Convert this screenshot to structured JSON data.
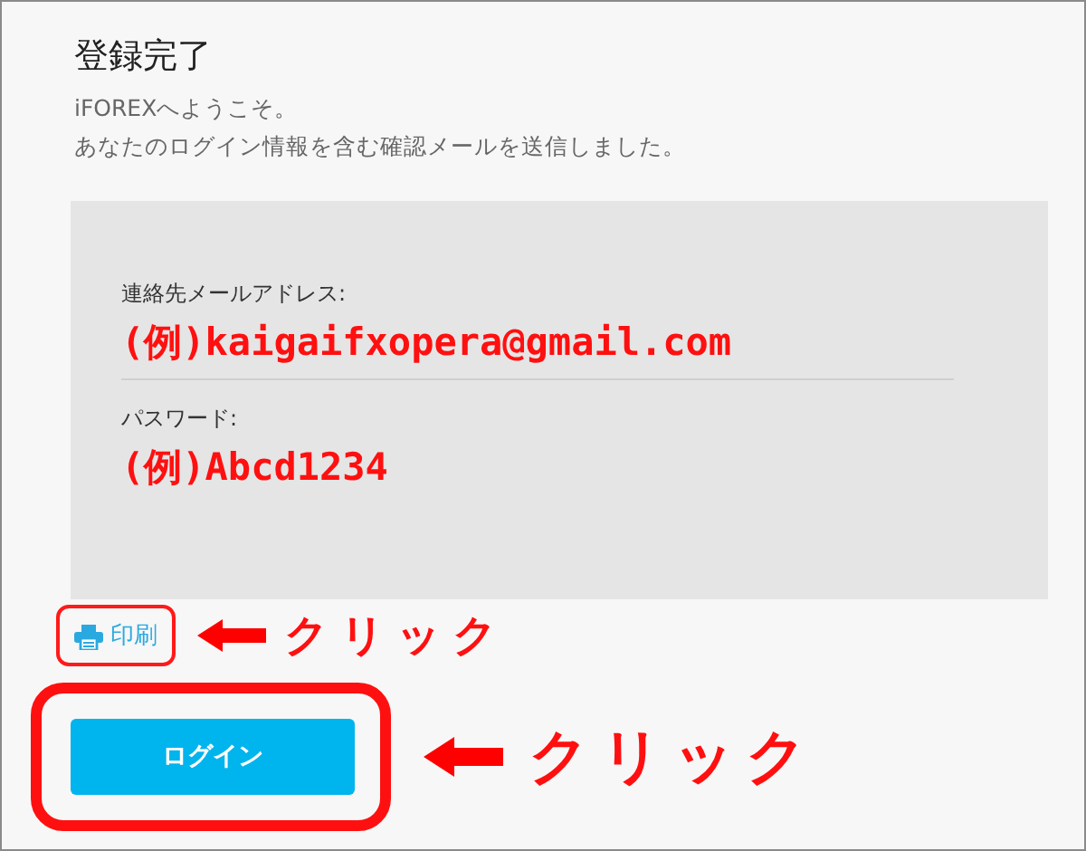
{
  "title": "登録完了",
  "intro": [
    "iFOREXへようこそ。",
    "あなたのログイン情報を含む確認メールを送信しました。"
  ],
  "credentials": [
    {
      "label": "連絡先メールアドレス:",
      "value": "(例)kaigaifxopera@gmail.com"
    },
    {
      "label": "パスワード:",
      "value": "(例)Abcd1234"
    }
  ],
  "print_link": "印刷",
  "print_annotation": "クリック",
  "login_button": "ログイン",
  "login_annotation": "クリック"
}
